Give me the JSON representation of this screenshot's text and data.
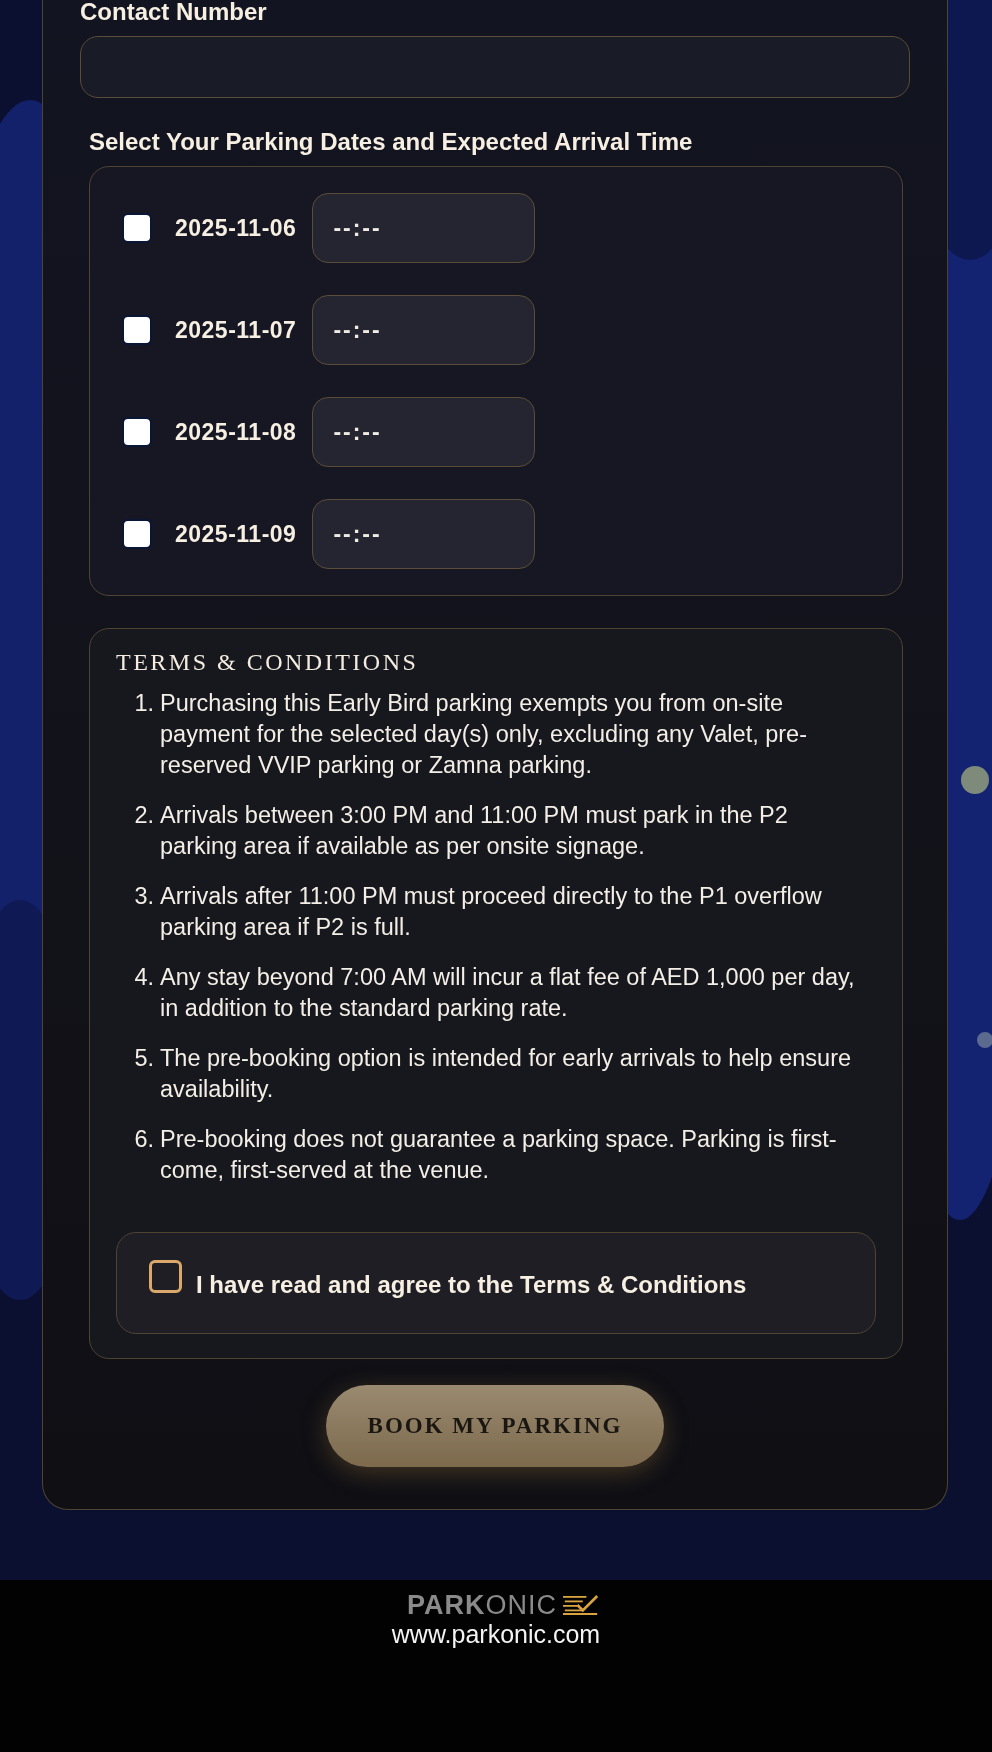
{
  "contact_field": {
    "label": "Contact Number"
  },
  "dates_section": {
    "heading": "Select Your Parking Dates and Expected Arrival Time",
    "dates": [
      {
        "date": "2025-11-06",
        "checked": false,
        "time_placeholder": "--:--"
      },
      {
        "date": "2025-11-07",
        "checked": false,
        "time_placeholder": "--:--"
      },
      {
        "date": "2025-11-08",
        "checked": false,
        "time_placeholder": "--:--"
      },
      {
        "date": "2025-11-09",
        "checked": false,
        "time_placeholder": "--:--"
      }
    ]
  },
  "terms": {
    "title": "TERMS & CONDITIONS",
    "items": [
      {
        "number": "1.",
        "text": "Purchasing this Early Bird parking exempts you from on-site payment for the selected day(s) only, excluding any Valet, pre-reserved VVIP parking or Zamna parking."
      },
      {
        "number": "2.",
        "text": "Arrivals between 3:00 PM and 11:00 PM must park in the P2 parking area if available as per onsite signage."
      },
      {
        "number": "3.",
        "text": "Arrivals after 11:00 PM must proceed directly to the P1 overflow parking area if P2 is full."
      },
      {
        "number": "4.",
        "text": "Any stay beyond 7:00 AM will incur a flat fee of AED 1,000 per day, in addition to the standard parking rate."
      },
      {
        "number": "5.",
        "text": "The pre-booking option is intended for early arrivals to help ensure availability."
      },
      {
        "number": "6.",
        "text": "Pre-booking does not guarantee a parking space. Parking is first-come, first-served at the venue."
      }
    ],
    "agree": {
      "label": "I have read and agree to the Terms & Conditions",
      "checked": false
    }
  },
  "submit_button": "BOOK MY PARKING",
  "footer": {
    "logo": "**PARK**ONIC",
    "url": "www.parkonic.com"
  }
}
